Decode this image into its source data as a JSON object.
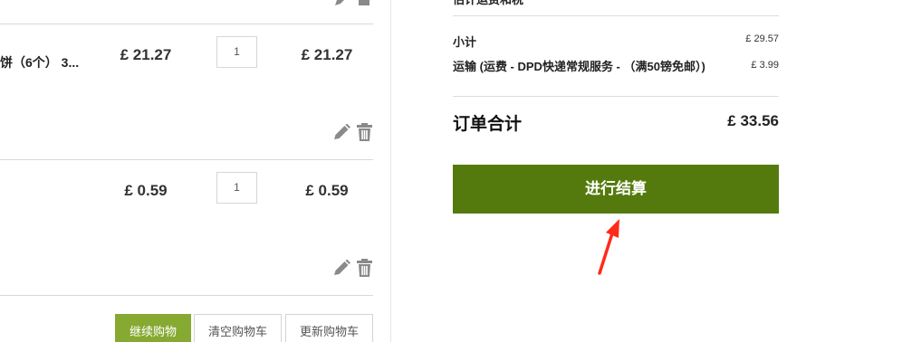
{
  "cart": {
    "items": [
      {
        "name": "饼（6个） 3...",
        "price": "£ 21.27",
        "quantity": "1",
        "subtotal": "£ 21.27"
      },
      {
        "name": "",
        "price": "£ 0.59",
        "quantity": "1",
        "subtotal": "£ 0.59"
      }
    ],
    "buttons": {
      "continue_shopping": "继续购物",
      "clear_cart": "清空购物车",
      "update_cart": "更新购物车"
    },
    "icons": {
      "edit": "pencil-icon",
      "delete": "trash-icon"
    }
  },
  "summary": {
    "header_partial": "估计运费和税",
    "subtotal_label": "小计",
    "subtotal_value": "£ 29.57",
    "shipping_label": "运输 (运费 - DPD快递常规服务 - （满50镑免邮）)",
    "shipping_value": "£ 3.99",
    "total_label": "订单合计",
    "total_value": "£ 33.56",
    "checkout_label": "进行结算"
  },
  "colors": {
    "checkout_button": "#547a0d",
    "continue_button": "#86a932",
    "annotation_arrow": "#ff2a1a"
  }
}
